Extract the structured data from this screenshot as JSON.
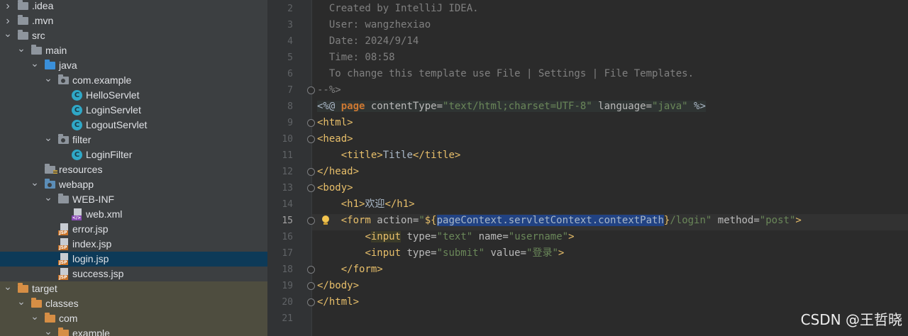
{
  "tree": [
    {
      "label": ".idea",
      "depth": 0,
      "arrow": "right",
      "icon": "folder-grey"
    },
    {
      "label": ".mvn",
      "depth": 0,
      "arrow": "right",
      "icon": "folder-grey"
    },
    {
      "label": "src",
      "depth": 0,
      "arrow": "down",
      "icon": "folder-grey"
    },
    {
      "label": "main",
      "depth": 1,
      "arrow": "down",
      "icon": "folder-grey"
    },
    {
      "label": "java",
      "depth": 2,
      "arrow": "down",
      "icon": "folder-blue"
    },
    {
      "label": "com.example",
      "depth": 3,
      "arrow": "down",
      "icon": "package"
    },
    {
      "label": "HelloServlet",
      "depth": 4,
      "arrow": "",
      "icon": "class"
    },
    {
      "label": "LoginServlet",
      "depth": 4,
      "arrow": "",
      "icon": "class"
    },
    {
      "label": "LogoutServlet",
      "depth": 4,
      "arrow": "",
      "icon": "class"
    },
    {
      "label": "filter",
      "depth": 3,
      "arrow": "down",
      "icon": "package"
    },
    {
      "label": "LoginFilter",
      "depth": 4,
      "arrow": "",
      "icon": "class"
    },
    {
      "label": "resources",
      "depth": 2,
      "arrow": "",
      "icon": "folder-resources"
    },
    {
      "label": "webapp",
      "depth": 2,
      "arrow": "down",
      "icon": "folder-web"
    },
    {
      "label": "WEB-INF",
      "depth": 3,
      "arrow": "down",
      "icon": "folder-grey"
    },
    {
      "label": "web.xml",
      "depth": 4,
      "arrow": "",
      "icon": "xml"
    },
    {
      "label": "error.jsp",
      "depth": 3,
      "arrow": "",
      "icon": "jsp"
    },
    {
      "label": "index.jsp",
      "depth": 3,
      "arrow": "",
      "icon": "jsp"
    },
    {
      "label": "login.jsp",
      "depth": 3,
      "arrow": "",
      "icon": "jsp",
      "selected": true
    },
    {
      "label": "success.jsp",
      "depth": 3,
      "arrow": "",
      "icon": "jsp"
    },
    {
      "label": "target",
      "depth": 0,
      "arrow": "down",
      "icon": "folder-orange",
      "excluded": true
    },
    {
      "label": "classes",
      "depth": 1,
      "arrow": "down",
      "icon": "folder-orange",
      "excluded": true
    },
    {
      "label": "com",
      "depth": 2,
      "arrow": "down",
      "icon": "folder-orange",
      "excluded": true
    },
    {
      "label": "example",
      "depth": 3,
      "arrow": "down",
      "icon": "folder-orange",
      "excluded": true
    }
  ],
  "editor": {
    "current_line": "15",
    "lines": [
      {
        "n": "2",
        "fold": false,
        "segments": [
          {
            "t": "  Created by IntelliJ IDEA.",
            "c": "comment"
          }
        ]
      },
      {
        "n": "3",
        "fold": false,
        "segments": [
          {
            "t": "  User: wangzhexiao",
            "c": "comment"
          }
        ]
      },
      {
        "n": "4",
        "fold": false,
        "segments": [
          {
            "t": "  Date: 2024/9/14",
            "c": "comment"
          }
        ]
      },
      {
        "n": "5",
        "fold": false,
        "segments": [
          {
            "t": "  Time: 08:58",
            "c": "comment"
          }
        ]
      },
      {
        "n": "6",
        "fold": false,
        "segments": [
          {
            "t": "  To change this template use File | Settings | File Templates.",
            "c": "comment"
          }
        ]
      },
      {
        "n": "7",
        "fold": true,
        "segments": [
          {
            "t": "--%>",
            "c": "comment"
          }
        ]
      },
      {
        "n": "8",
        "fold": false,
        "bg": "directive",
        "segments": [
          {
            "t": "<%@ ",
            "c": "el"
          },
          {
            "t": "page",
            "c": "kw"
          },
          {
            "t": " contentType=",
            "c": "attr"
          },
          {
            "t": "\"text/html;charset=UTF-8\"",
            "c": "str"
          },
          {
            "t": " language=",
            "c": "attr"
          },
          {
            "t": "\"java\"",
            "c": "str"
          },
          {
            "t": " %>",
            "c": "el"
          }
        ]
      },
      {
        "n": "9",
        "fold": true,
        "segments": [
          {
            "t": "<html>",
            "c": "tagc"
          }
        ]
      },
      {
        "n": "10",
        "fold": true,
        "segments": [
          {
            "t": "<head>",
            "c": "tagc"
          }
        ]
      },
      {
        "n": "11",
        "fold": false,
        "segments": [
          {
            "t": "    ",
            "c": "el"
          },
          {
            "t": "<title>",
            "c": "tagc"
          },
          {
            "t": "Title",
            "c": "el"
          },
          {
            "t": "</title>",
            "c": "tagc"
          }
        ]
      },
      {
        "n": "12",
        "fold": true,
        "segments": [
          {
            "t": "</head>",
            "c": "tagc"
          }
        ]
      },
      {
        "n": "13",
        "fold": true,
        "segments": [
          {
            "t": "<body>",
            "c": "tagc"
          }
        ]
      },
      {
        "n": "14",
        "fold": false,
        "segments": [
          {
            "t": "    ",
            "c": "el"
          },
          {
            "t": "<h1>",
            "c": "tagc"
          },
          {
            "t": "欢迎",
            "c": "el"
          },
          {
            "t": "</h1>",
            "c": "tagc"
          }
        ]
      },
      {
        "n": "15",
        "fold": true,
        "current": true,
        "segments": [
          {
            "t": "    ",
            "c": "el"
          },
          {
            "t": "<form",
            "c": "tagc"
          },
          {
            "t": " action=",
            "c": "attr"
          },
          {
            "t": "\"",
            "c": "str"
          },
          {
            "t": "${",
            "c": "tagc"
          },
          {
            "t": "pageContext.servletContext.contextPath",
            "c": "sel"
          },
          {
            "t": "}",
            "c": "tagc"
          },
          {
            "t": "/login\"",
            "c": "str"
          },
          {
            "t": " method=",
            "c": "attr"
          },
          {
            "t": "\"post\"",
            "c": "str"
          },
          {
            "t": ">",
            "c": "tagc"
          }
        ]
      },
      {
        "n": "16",
        "fold": false,
        "segments": [
          {
            "t": "        ",
            "c": "el"
          },
          {
            "t": "<",
            "c": "tagc"
          },
          {
            "t": "input",
            "c": "hl"
          },
          {
            "t": " type=",
            "c": "attr"
          },
          {
            "t": "\"text\"",
            "c": "str"
          },
          {
            "t": " name=",
            "c": "attr"
          },
          {
            "t": "\"username\"",
            "c": "str"
          },
          {
            "t": ">",
            "c": "tagc"
          }
        ]
      },
      {
        "n": "17",
        "fold": false,
        "segments": [
          {
            "t": "        ",
            "c": "el"
          },
          {
            "t": "<input",
            "c": "tagc"
          },
          {
            "t": " type=",
            "c": "attr"
          },
          {
            "t": "\"submit\"",
            "c": "str"
          },
          {
            "t": " value=",
            "c": "attr"
          },
          {
            "t": "\"登录\"",
            "c": "str"
          },
          {
            "t": ">",
            "c": "tagc"
          }
        ]
      },
      {
        "n": "18",
        "fold": true,
        "segments": [
          {
            "t": "    ",
            "c": "el"
          },
          {
            "t": "</form>",
            "c": "tagc"
          }
        ]
      },
      {
        "n": "19",
        "fold": true,
        "segments": [
          {
            "t": "</body>",
            "c": "tagc"
          }
        ]
      },
      {
        "n": "20",
        "fold": true,
        "segments": [
          {
            "t": "</html>",
            "c": "tagc"
          }
        ]
      },
      {
        "n": "21",
        "fold": false,
        "segments": []
      }
    ]
  },
  "watermark": "CSDN @王哲晓"
}
